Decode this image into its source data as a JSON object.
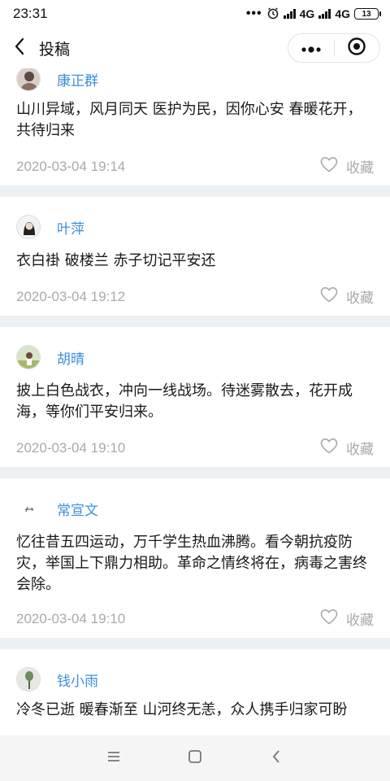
{
  "status_bar": {
    "time": "23:31",
    "dots": "•••",
    "network_1": "4G",
    "network_2": "4G",
    "battery": "13"
  },
  "nav": {
    "title": "投稿"
  },
  "posts": [
    {
      "author": "康正群",
      "content": "山川异域，风月同天 医护为民，因你心安 春暖花开，共待归来",
      "date": "2020-03-04 19:14",
      "fav_label": "收藏"
    },
    {
      "author": "叶萍",
      "content": "衣白褂 破楼兰 赤子切记平安还",
      "date": "2020-03-04 19:12",
      "fav_label": "收藏"
    },
    {
      "author": "胡晴",
      "content": "披上白色战衣，冲向一线战场。待迷雾散去，花开成海，等你们平安归来。",
      "date": "2020-03-04 19:10",
      "fav_label": "收藏"
    },
    {
      "author": "常宣文",
      "content": "忆往昔五四运动，万千学生热血沸腾。看今朝抗疫防灾，举国上下鼎力相助。革命之情终将在，病毒之害终会除。",
      "date": "2020-03-04 19:10",
      "fav_label": "收藏"
    },
    {
      "author": "钱小雨",
      "content": "冷冬已逝 暖春渐至 山河终无恙，众人携手归家可盼",
      "date": "",
      "fav_label": ""
    }
  ],
  "colors": {
    "author_name": "#3c8fdb",
    "meta_gray": "#aaaaaa",
    "divider": "#eef1f4"
  },
  "icons": {
    "back": "chevron-left-icon",
    "more": "more-dots-icon",
    "close": "target-circle-icon",
    "fav": "heart-outline-icon",
    "menu": "menu-lines-icon",
    "home": "square-home-icon",
    "nav_back": "triangle-back-icon"
  }
}
